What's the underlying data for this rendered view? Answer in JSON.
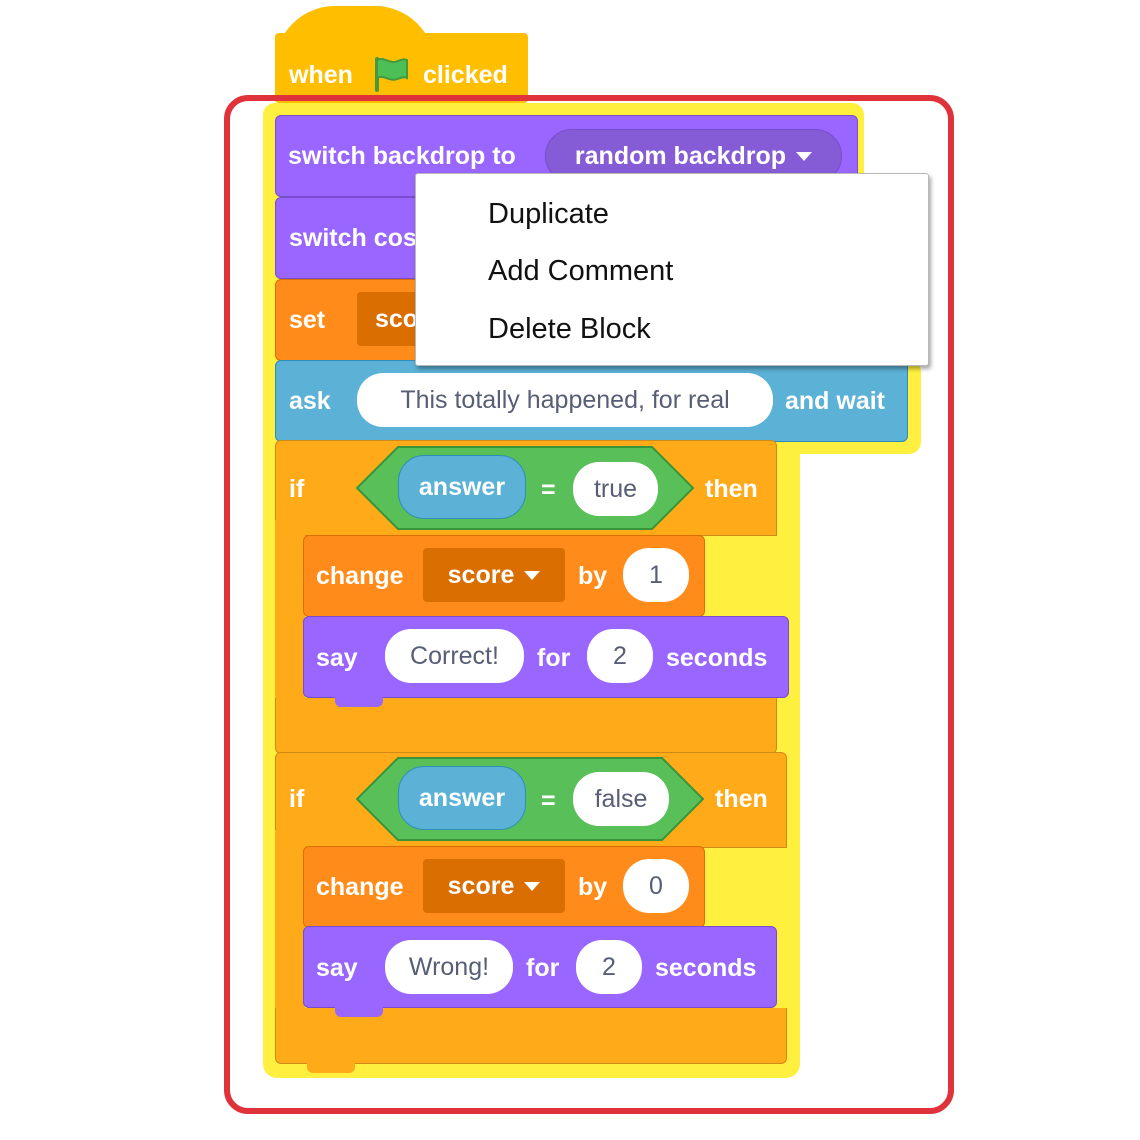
{
  "colors": {
    "event": "#ffbf00",
    "looks": "#9966ff",
    "variables": "#ff8c1a",
    "sensing": "#5cb1d6",
    "control": "#ffab19",
    "operators": "#59c059",
    "highlight": "#ffef3f",
    "selection_frame": "#e0323a"
  },
  "hat": {
    "when": "when",
    "flag_icon": "green-flag-icon",
    "clicked": "clicked"
  },
  "switch_backdrop": {
    "label": "switch backdrop to",
    "value": "random backdrop"
  },
  "switch_costume": {
    "label": "switch cos"
  },
  "set_block": {
    "label": "set",
    "value": "sco"
  },
  "ask_block": {
    "label": "ask",
    "question": "This totally happened, for real",
    "suffix": "and wait"
  },
  "if_true": {
    "if": "if",
    "reporter": "answer",
    "op": "=",
    "value": "true",
    "then": "then",
    "change": {
      "label": "change",
      "var": "score",
      "by": "by",
      "amount": "1"
    },
    "say": {
      "label": "say",
      "text": "Correct!",
      "for": "for",
      "secs": "2",
      "unit": "seconds"
    }
  },
  "if_false": {
    "if": "if",
    "reporter": "answer",
    "op": "=",
    "value": "false",
    "then": "then",
    "change": {
      "label": "change",
      "var": "score",
      "by": "by",
      "amount": "0"
    },
    "say": {
      "label": "say",
      "text": "Wrong!",
      "for": "for",
      "secs": "2",
      "unit": "seconds"
    }
  },
  "context_menu": {
    "items": [
      "Duplicate",
      "Add Comment",
      "Delete Block"
    ]
  }
}
